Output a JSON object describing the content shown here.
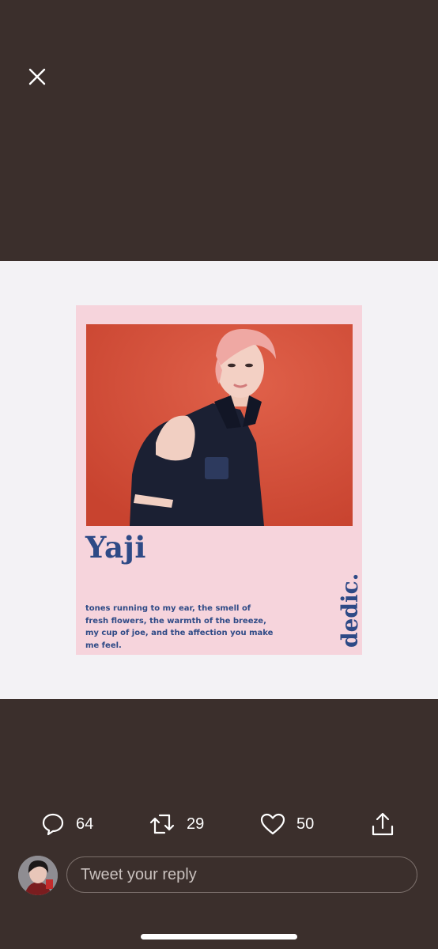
{
  "toolbar": {
    "close_icon": "close-icon"
  },
  "post_image": {
    "name": "Yaji",
    "caption": "tones running to my ear, the smell of fresh flowers, the warmth of the breeze, my cup of joe, and the affection you make me feel.",
    "brand": "dedic.",
    "colors": {
      "card_bg": "#f6d4dc",
      "photo_bg": "#d8533f",
      "text": "#2e4a86"
    }
  },
  "actions": {
    "reply": {
      "icon": "reply-icon",
      "count": "64"
    },
    "retweet": {
      "icon": "retweet-icon",
      "count": "29"
    },
    "like": {
      "icon": "heart-icon",
      "count": "50"
    },
    "share": {
      "icon": "share-icon"
    }
  },
  "reply": {
    "placeholder": "Tweet your reply"
  },
  "colors": {
    "background": "#3b2f2c",
    "media_band": "#f3f2f5",
    "accent_text": "#ffffff"
  }
}
